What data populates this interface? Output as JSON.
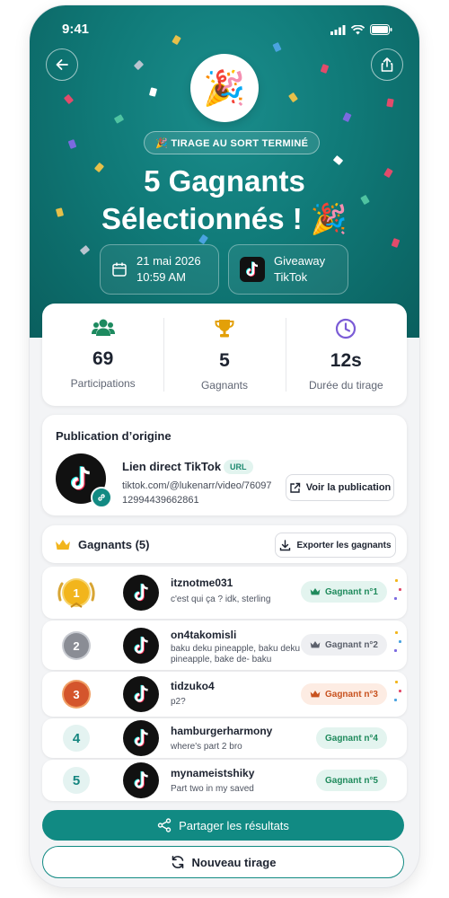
{
  "status_bar": {
    "time": "9:41"
  },
  "header": {
    "badge": "🎉 TIRAGE AU SORT TERMINÉ",
    "title_line1": "5 Gagnants",
    "title_line2": "Sélectionnés ! 🎉",
    "date": "21 mai 2026",
    "time": "10:59 AM",
    "giveaway_line1": "Giveaway",
    "giveaway_line2": "TikTok",
    "party_icon": "🎉"
  },
  "stats": [
    {
      "icon": "users-icon",
      "value": "69",
      "label": "Participations",
      "color": "#1d8a5f"
    },
    {
      "icon": "trophy-icon",
      "value": "5",
      "label": "Gagnants",
      "color": "#e3a008"
    },
    {
      "icon": "clock-icon",
      "value": "12s",
      "label": "Durée du tirage",
      "color": "#7b5cd6"
    }
  ],
  "origin": {
    "section_title": "Publication d’origine",
    "title": "Lien direct TikTok",
    "badge": "URL",
    "url": "tiktok.com/@lukenarr/video/7609712994439662861",
    "button": "Voir la publication"
  },
  "winners": {
    "section_title": "Gagnants (5)",
    "export_button": "Exporter les gagnants",
    "items": [
      {
        "rank": "1",
        "name": "itznotme031",
        "comment": "c'est qui ça ? idk, sterling",
        "badge": "Gagnant n°1"
      },
      {
        "rank": "2",
        "name": "on4takomisli",
        "comment": "baku deku pineapple, baku deku pineapple, bake de- baku",
        "badge": "Gagnant n°2"
      },
      {
        "rank": "3",
        "name": "tidzuko4",
        "comment": "p2?",
        "badge": "Gagnant n°3"
      },
      {
        "rank": "4",
        "name": "hamburgerharmony",
        "comment": "where's part 2 bro",
        "badge": "Gagnant n°4"
      },
      {
        "rank": "5",
        "name": "mynameistshiky",
        "comment": "Part two in my saved",
        "badge": "Gagnant n°5"
      }
    ]
  },
  "actions": {
    "share": "Partager les résultats",
    "new_draw": "Nouveau tirage"
  },
  "colors": {
    "primary": "#118a83",
    "gold": "#f2b51c",
    "silver": "#8a8d95",
    "bronze": "#d4552c"
  }
}
